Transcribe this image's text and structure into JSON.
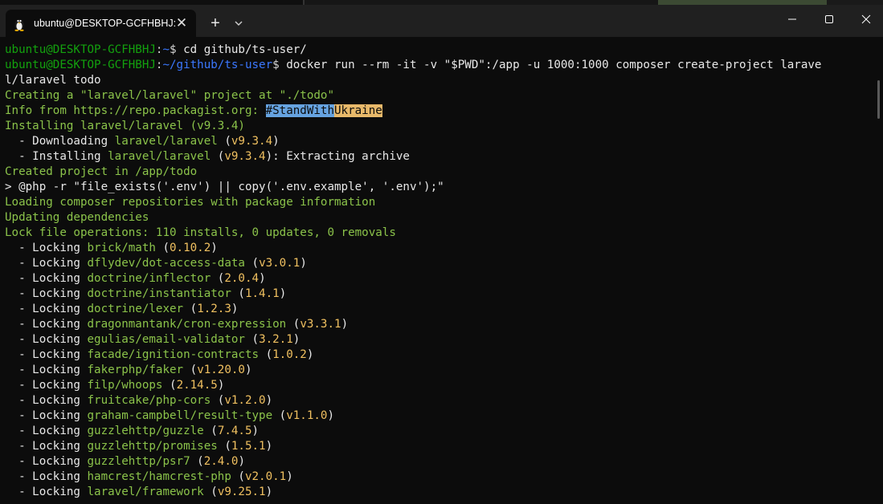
{
  "window": {
    "tab_title": "ubuntu@DESKTOP-GCFHBHJ:",
    "tab_close": "✕",
    "new_tab": "+"
  },
  "prompt": {
    "user_host": "ubuntu@DESKTOP-GCFHBHJ",
    "path_home": "~",
    "path_repo": "~/github/ts-user"
  },
  "commands": {
    "cmd1": " cd github/ts-user/",
    "cmd2a": " docker run --rm -it -v \"$PWD\":/app -u 1000:1000 composer create-project larave",
    "cmd2b": "l/laravel todo"
  },
  "output": {
    "creating": "Creating a \"laravel/laravel\" project at \"./todo\"",
    "info_prefix": "Info from https://repo.packagist.org: ",
    "info_hl1": "#StandWith",
    "info_hl2": "Ukraine",
    "installing": "Installing laravel/laravel (v9.3.4)",
    "downloading_prefix": "  - Downloading ",
    "downloading_pkg": "laravel/laravel",
    "downloading_ver": "v9.3.4",
    "installing2_prefix": "  - Installing ",
    "installing2_pkg": "laravel/laravel",
    "installing2_ver": "v9.3.4",
    "installing2_suffix": ": Extracting archive",
    "created": "Created project in /app/todo",
    "php_cmd": "> @php -r \"file_exists('.env') || copy('.env.example', '.env');\"",
    "loading": "Loading composer repositories with package information",
    "updating": "Updating dependencies",
    "lock_ops": "Lock file operations: 110 installs, 0 updates, 0 removals",
    "locking_prefix": "  - Locking "
  },
  "locks": [
    {
      "pkg": "brick/math",
      "ver": "0.10.2"
    },
    {
      "pkg": "dflydev/dot-access-data",
      "ver": "v3.0.1"
    },
    {
      "pkg": "doctrine/inflector",
      "ver": "2.0.4"
    },
    {
      "pkg": "doctrine/instantiator",
      "ver": "1.4.1"
    },
    {
      "pkg": "doctrine/lexer",
      "ver": "1.2.3"
    },
    {
      "pkg": "dragonmantank/cron-expression",
      "ver": "v3.3.1"
    },
    {
      "pkg": "egulias/email-validator",
      "ver": "3.2.1"
    },
    {
      "pkg": "facade/ignition-contracts",
      "ver": "1.0.2"
    },
    {
      "pkg": "fakerphp/faker",
      "ver": "v1.20.0"
    },
    {
      "pkg": "filp/whoops",
      "ver": "2.14.5"
    },
    {
      "pkg": "fruitcake/php-cors",
      "ver": "v1.2.0"
    },
    {
      "pkg": "graham-campbell/result-type",
      "ver": "v1.1.0"
    },
    {
      "pkg": "guzzlehttp/guzzle",
      "ver": "7.4.5"
    },
    {
      "pkg": "guzzlehttp/promises",
      "ver": "1.5.1"
    },
    {
      "pkg": "guzzlehttp/psr7",
      "ver": "2.4.0"
    },
    {
      "pkg": "hamcrest/hamcrest-php",
      "ver": "v2.0.1"
    },
    {
      "pkg": "laravel/framework",
      "ver": "v9.25.1"
    }
  ],
  "colors": {
    "background": "#0c0c0c",
    "titlebar": "#202020",
    "prompt_user": "#13a10e",
    "prompt_path": "#3b78ff",
    "output_green": "#8bc34a",
    "version_yellow": "#f0c060"
  }
}
